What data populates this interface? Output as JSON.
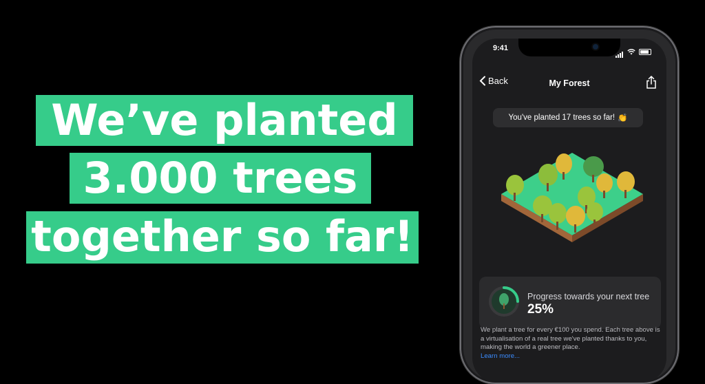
{
  "headline": {
    "line1": "We’ve planted",
    "line2": "3.000 trees",
    "line3": "together so far!"
  },
  "phone": {
    "status_time": "9:41",
    "nav": {
      "back_label": "Back",
      "title": "My Forest"
    },
    "summary_pill": "You've planted 17 trees so far!",
    "summary_emoji": "👏",
    "progress": {
      "label": "Progress towards your next tree",
      "value_text": "25%",
      "fraction": 0.25
    },
    "info_text": "We plant a tree for every €100 you spend. Each tree above is a virtualisation of a real tree we've planted thanks to you, making the world a greener place.",
    "learn_more": "Learn more..."
  },
  "colors": {
    "banner_green": "#36cc8a",
    "background": "#000000",
    "screen_bg": "#1c1c1e",
    "accent_link": "#3b8cff"
  }
}
